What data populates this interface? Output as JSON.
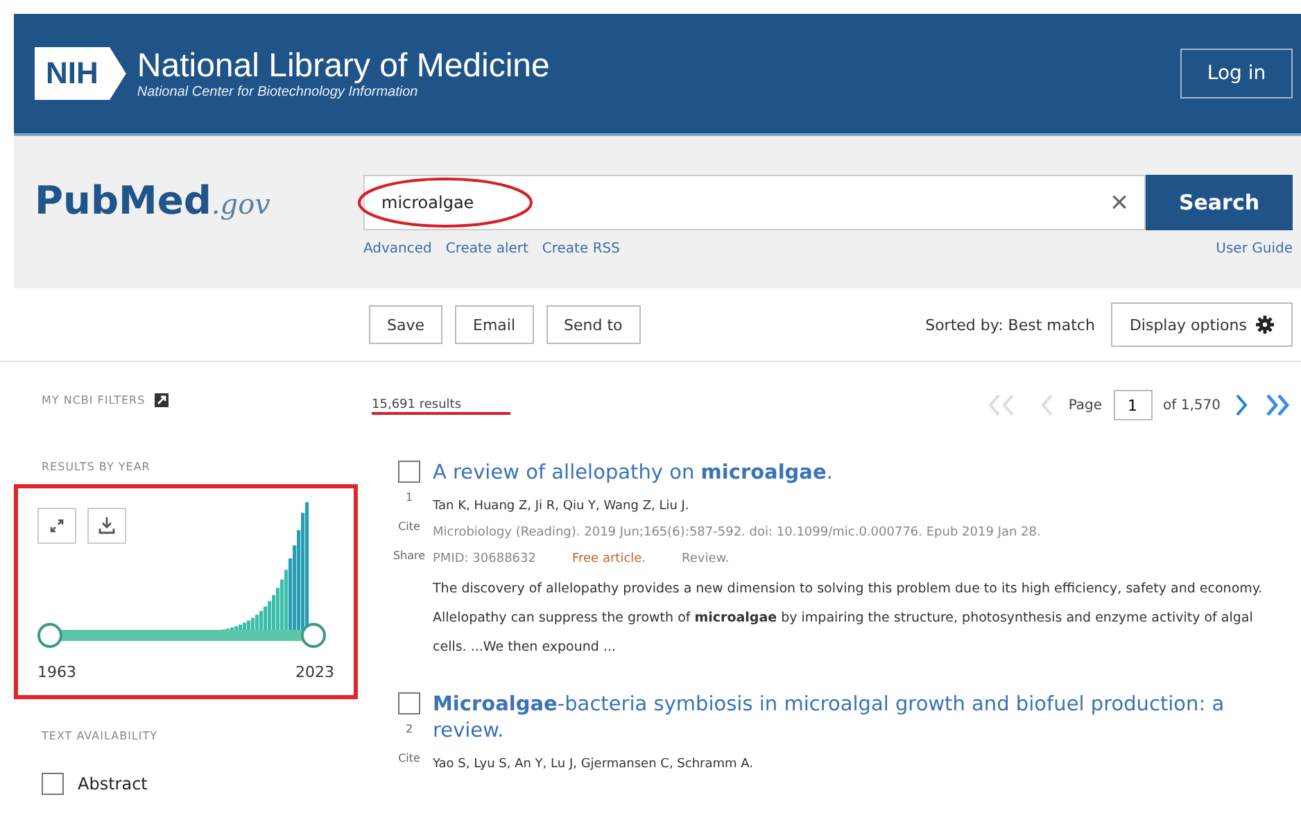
{
  "header": {
    "nih_mark": "NIH",
    "title": "National Library of Medicine",
    "subtitle": "National Center for Biotechnology Information",
    "login": "Log in"
  },
  "logo": {
    "name": "PubMed",
    "suffix": ".gov"
  },
  "search": {
    "value": "microalgae",
    "clear": "×",
    "button": "Search",
    "links": [
      "Advanced",
      "Create alert",
      "Create RSS"
    ],
    "guide": "User Guide"
  },
  "toolbar": {
    "buttons": [
      "Save",
      "Email",
      "Send to"
    ],
    "sorted": "Sorted by: Best match",
    "display": "Display options"
  },
  "sidebar": {
    "filters": "MY NCBI FILTERS",
    "by_year": "RESULTS BY YEAR",
    "year_start": "1963",
    "year_end": "2023",
    "year_range": {
      "level": 1
    },
    "availability": "TEXT AVAILABILITY",
    "options": [
      {
        "label": "Abstract",
        "checked": false
      }
    ]
  },
  "results_count": "15,691 results",
  "pagination": {
    "page_label": "Page",
    "page": "1",
    "of": "of 1,570",
    "prev_disabled": true
  },
  "results": [
    {
      "number": "1",
      "selected": false,
      "title": "A review of allelopathy on **microalgae**.",
      "authors": "Tan K, Huang Z, Ji R, Qiu Y, Wang Z, Liu J.",
      "citation": "Microbiology (Reading). 2019 Jun;165(6):587-592. doi: 10.1099/mic.0.000776. Epub 2019 Jan 28.",
      "pmid": "PMID: 30688632",
      "free": "Free article.",
      "type": "Review.",
      "snippet": "The discovery of allelopathy provides a new dimension to solving this problem due to its high efficiency, safety and economy. Allelopathy can suppress the growth of **microalgae** by impairing the structure, photosynthesis and enzyme activity of algal cells. ...We then expound ...",
      "actions": [
        "Cite",
        "Share"
      ]
    },
    {
      "number": "2",
      "selected": false,
      "title": "**Microalgae**-bacteria symbiosis in microalgal growth and biofuel production: a review.",
      "authors": "Yao S, Lyu S, An Y, Lu J, Gjermansen C, Schramm A.",
      "actions": [
        "Cite"
      ]
    }
  ]
}
